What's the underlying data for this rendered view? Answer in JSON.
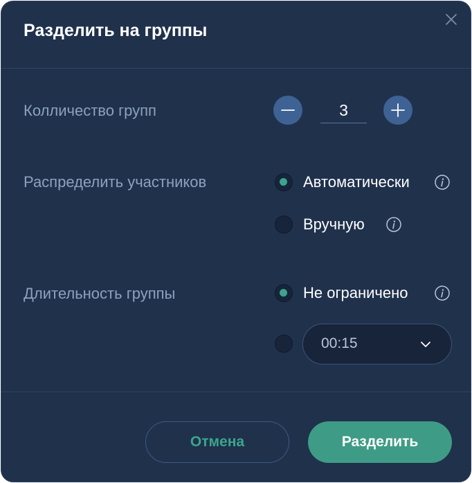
{
  "dialog": {
    "title": "Разделить на группы"
  },
  "group_count": {
    "label": "Колличество групп",
    "value": "3"
  },
  "distribute": {
    "label": "Распределить участников",
    "options": [
      {
        "label": "Автоматически",
        "checked": true
      },
      {
        "label": "Вручную",
        "checked": false
      }
    ]
  },
  "duration": {
    "label": "Длительность группы",
    "options": [
      {
        "label": "Не ограничено",
        "checked": true
      },
      {
        "label": "",
        "checked": false
      }
    ],
    "time_value": "00:15"
  },
  "footer": {
    "cancel_label": "Отмена",
    "split_label": "Разделить"
  },
  "colors": {
    "background": "#20314c",
    "accent": "#3ba58c",
    "button_blue": "#3e6294",
    "label": "#8ba2bd"
  },
  "icons": [
    "close-icon",
    "minus-icon",
    "plus-icon",
    "info-icon",
    "chevron-down-icon"
  ]
}
